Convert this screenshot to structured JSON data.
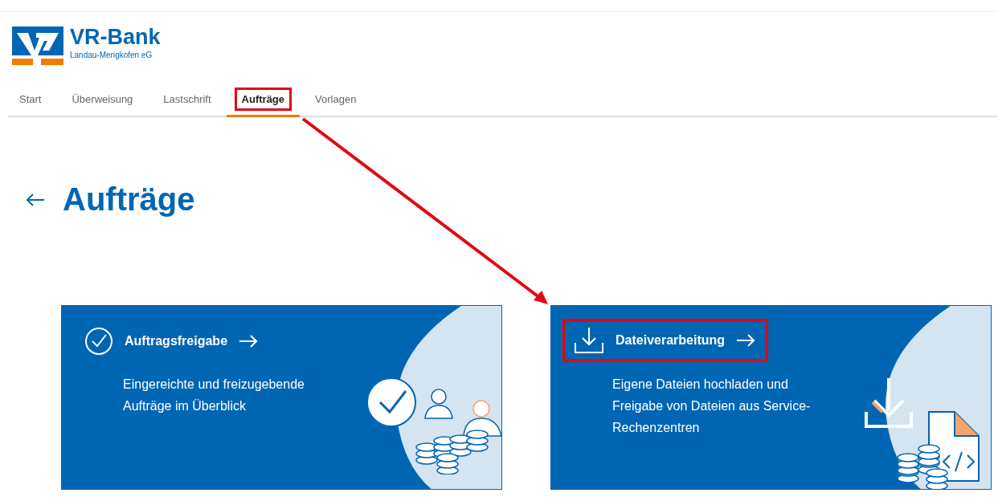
{
  "logo": {
    "name": "VR-Bank",
    "subtitle": "Landau-Mengkofen eG"
  },
  "tabs": [
    {
      "label": "Start",
      "selected": false,
      "highlighted": false
    },
    {
      "label": "Überweisung",
      "selected": false,
      "highlighted": false
    },
    {
      "label": "Lastschrift",
      "selected": false,
      "highlighted": false
    },
    {
      "label": "Aufträge",
      "selected": true,
      "highlighted": true
    },
    {
      "label": "Vorlagen",
      "selected": false,
      "highlighted": false
    }
  ],
  "page_title": "Aufträge",
  "cards": [
    {
      "kind": "approval",
      "title": "Auftragsfreigabe",
      "description": "Eingereichte und freizugebende Aufträge im Überblick",
      "highlighted": false
    },
    {
      "kind": "upload",
      "title": "Dateiverarbeitung",
      "description": "Eigene Dateien hochladen und Freigabe von Dateien aus Service-Rechenzentren",
      "highlighted": true
    }
  ],
  "annotation_arrow": true
}
